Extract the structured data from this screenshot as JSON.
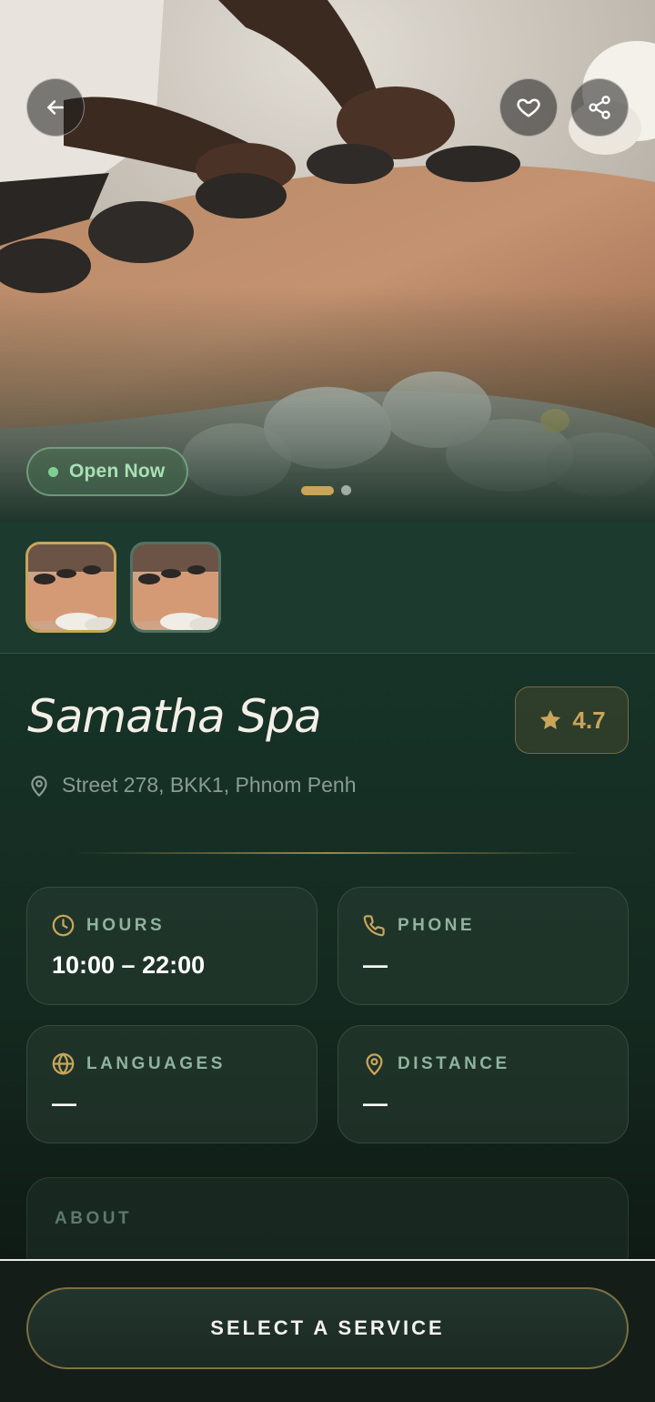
{
  "hero": {
    "status_badge": "Open Now",
    "carousel": {
      "count": 2,
      "active_index": 0
    }
  },
  "spa": {
    "name": "Samatha Spa",
    "rating": "4.7",
    "address": "Street 278, BKK1, Phnom Penh"
  },
  "info_cards": {
    "hours": {
      "label": "HOURS",
      "value": "10:00 – 22:00"
    },
    "phone": {
      "label": "PHONE",
      "value": "—"
    },
    "languages": {
      "label": "LANGUAGES",
      "value": "—"
    },
    "distance": {
      "label": "DISTANCE",
      "value": "—"
    }
  },
  "about": {
    "label": "ABOUT"
  },
  "footer": {
    "cta_label": "SELECT A SERVICE"
  },
  "icons": {
    "back": "arrow-left-icon",
    "favorite": "heart-icon",
    "share": "share-icon",
    "rating": "star-icon",
    "address": "map-pin-icon",
    "hours": "clock-icon",
    "phone": "phone-icon",
    "languages": "globe-icon",
    "distance": "map-pin-icon"
  },
  "colors": {
    "accent_gold": "#c9a55a",
    "open_green": "#a8e0b4",
    "label_green": "#8fb39f",
    "background": "#13241d"
  }
}
